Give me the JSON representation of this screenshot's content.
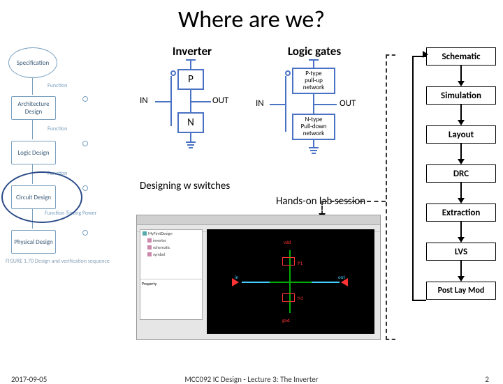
{
  "title": "Where are we?",
  "columns": {
    "left": "Inverter",
    "right": "Logic gates"
  },
  "inverter": {
    "p": "P",
    "n": "N",
    "in": "IN",
    "out": "OUT"
  },
  "logic": {
    "ptype": "P-type\npull-up\nnetwork",
    "ntype": "N-type\nPull-down\nnetwork",
    "in": "IN",
    "out": "OUT"
  },
  "designing": "Designing w switches",
  "hands_on": "Hands-on lab session",
  "left_flow": {
    "spec": "Specification",
    "arch": "Architecture\nDesign",
    "logic": "Logic\nDesign",
    "circuit": "Circuit\nDesign",
    "physical": "Physical\nDesign",
    "arrow_label": "Function",
    "ftp": "Function\nTiming\nPower",
    "caption": "FIGURE 1.70 Design and verification sequence"
  },
  "right_flow": {
    "items": [
      "Schematic",
      "Simulation",
      "Layout",
      "DRC",
      "Extraction",
      "LVS",
      "Post Lay Mod"
    ]
  },
  "footer": {
    "date": "2017-09-05",
    "mid": "MCC092 IC Design - Lecture 3: The Inverter",
    "page": "2"
  }
}
